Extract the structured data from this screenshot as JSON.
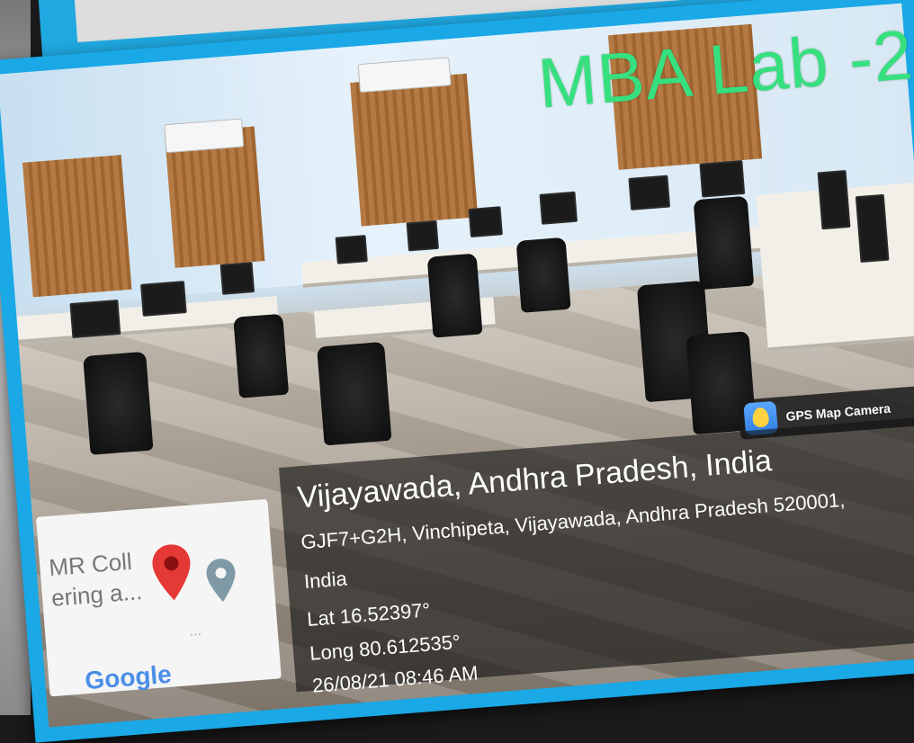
{
  "photo": {
    "overlay_title": "MBA Lab -2",
    "title_color": "#36e07e"
  },
  "badge": {
    "app_name": "GPS Map Camera",
    "icon": "gps-map-camera-icon"
  },
  "map": {
    "label_line1": "MR Coll",
    "label_line2": "ering a...",
    "dots": "...",
    "brand": "Google",
    "red_pin": "red-location-pin-icon",
    "grey_pin": "grey-location-pin-icon"
  },
  "location": {
    "city": "Vijayawada, Andhra Pradesh, India",
    "address": "GJF7+G2H, Vinchipeta, Vijayawada, Andhra Pradesh 520001,",
    "country": "India",
    "lat": "Lat 16.52397°",
    "long": "Long 80.612535°",
    "timestamp": "26/08/21 08:46 AM"
  },
  "colors": {
    "frame": "#1aa8e6",
    "panel": "rgba(20,20,20,.62)"
  }
}
